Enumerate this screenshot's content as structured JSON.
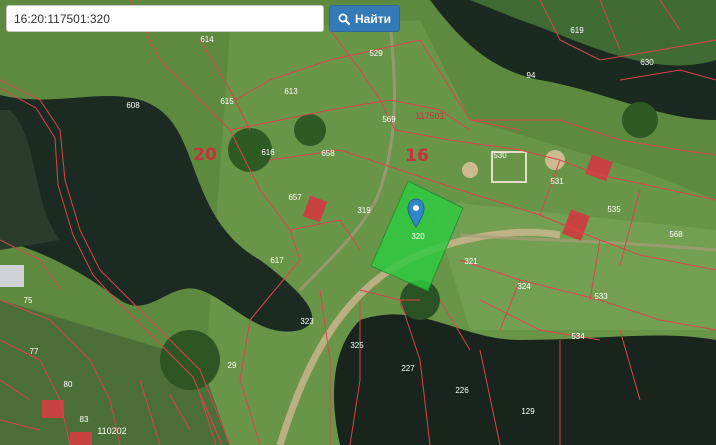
{
  "search": {
    "value": "16:20:117501:320",
    "button_label": "Найти",
    "button_icon": "search-icon"
  },
  "map": {
    "zone_labels": [
      "20",
      "16"
    ],
    "quarter_labels": [
      "117501",
      "110202"
    ],
    "parcel_labels": [
      "614",
      "529",
      "619",
      "630",
      "94",
      "608",
      "615",
      "613",
      "569",
      "616",
      "658",
      "530",
      "531",
      "657",
      "319",
      "535",
      "320",
      "617",
      "321",
      "324",
      "568",
      "323",
      "533",
      "534",
      "325",
      "29",
      "227",
      "226",
      "129",
      "75",
      "77",
      "80",
      "83"
    ],
    "selected_parcel": "320",
    "marker_icon": "map-pin-icon",
    "highlight_color": "#2ecc40",
    "boundary_color": "#d9454b"
  }
}
